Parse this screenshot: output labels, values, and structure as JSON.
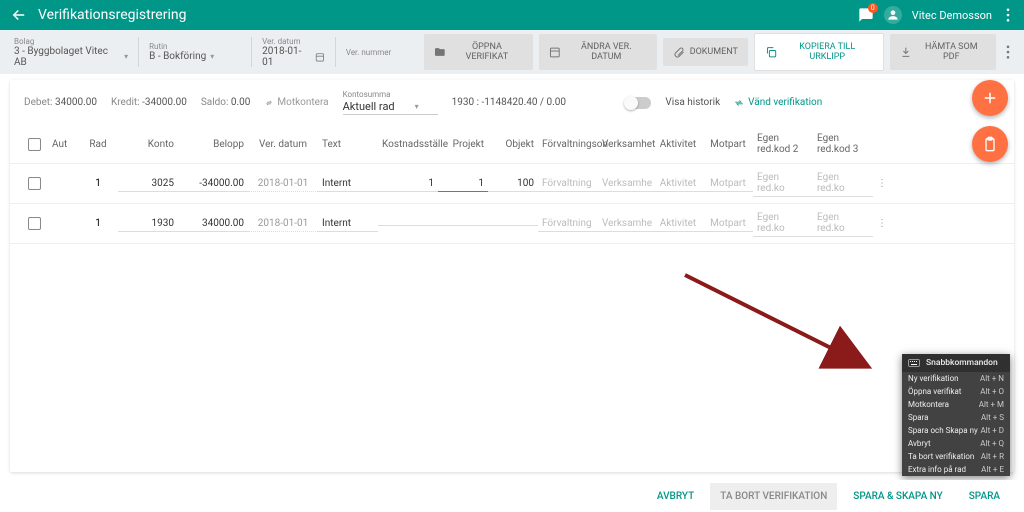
{
  "appbar": {
    "title": "Verifikationsregistrering",
    "badge": "0",
    "user": "Vitec Demosson"
  },
  "filters": {
    "bolag_label": "Bolag",
    "bolag_value": "3 - Byggbolaget Vitec AB",
    "rutin_label": "Rutin",
    "rutin_value": "B - Bokföring",
    "verdatum_label": "Ver. datum",
    "verdatum_value": "2018-01-01",
    "vernummer_label": "Ver. nummer",
    "vernummer_value": ""
  },
  "actions": {
    "open": "ÖPPNA VERIFIKAT",
    "change": "ÄNDRA VER. DATUM",
    "document": "DOKUMENT",
    "copy": "KOPIERA TILL URKLIPP",
    "pdf": "HÄMTA SOM PDF"
  },
  "summary": {
    "debet_lbl": "Debet:",
    "debet_val": "34000.00",
    "kredit_lbl": "Kredit:",
    "kredit_val": "-34000.00",
    "saldo_lbl": "Saldo:",
    "saldo_val": "0.00",
    "motkontera": "Motkontera",
    "kontosumma_lbl": "Kontosumma",
    "kontosumma_val": "Aktuell rad",
    "balance": "1930 : -1148420.40 / 0.00",
    "historik": "Visa historik",
    "vand": "Vänd verifikation"
  },
  "headers": {
    "aut": "Aut",
    "rad": "Rad",
    "konto": "Konto",
    "belopp": "Belopp",
    "verdatum": "Ver. datum",
    "text": "Text",
    "kost": "Kostnadsställe",
    "projekt": "Projekt",
    "objekt": "Objekt",
    "forv": "Förvaltningson",
    "verk": "Verksamhet",
    "akt": "Aktivitet",
    "mot": "Motpart",
    "red2": "Egen red.kod 2",
    "red3": "Egen red.kod 3"
  },
  "rows": [
    {
      "rad": "1",
      "konto": "3025",
      "belopp": "-34000.00",
      "date": "2018-01-01",
      "text": "Internt",
      "kost": "1",
      "proj": "1",
      "obj": "100",
      "forv": "Förvaltning",
      "verk": "Verksamhe",
      "akt": "Aktivitet",
      "mot": "Motpart",
      "red2": "Egen red.ko",
      "red3": "Egen red.ko"
    },
    {
      "rad": "1",
      "konto": "1930",
      "belopp": "34000.00",
      "date": "2018-01-01",
      "text": "Internt",
      "kost": "",
      "proj": "",
      "obj": "",
      "forv": "Förvaltning",
      "verk": "Verksamhe",
      "akt": "Aktivitet",
      "mot": "Motpart",
      "red2": "Egen red.ko",
      "red3": "Egen red.ko"
    }
  ],
  "shortcuts": {
    "title": "Snabbkommandon",
    "items": [
      {
        "label": "Ny verifikation",
        "key": "Alt + N"
      },
      {
        "label": "Öppna verifikat",
        "key": "Alt + O"
      },
      {
        "label": "Motkontera",
        "key": "Alt + M"
      },
      {
        "label": "Spara",
        "key": "Alt + S"
      },
      {
        "label": "Spara och Skapa ny",
        "key": "Alt + D"
      },
      {
        "label": "Avbryt",
        "key": "Alt + Q"
      },
      {
        "label": "Ta bort verifikation",
        "key": "Alt + R"
      },
      {
        "label": "Extra info på rad",
        "key": "Alt + E"
      }
    ]
  },
  "footer": {
    "cancel": "AVBRYT",
    "delete": "TA BORT VERIFIKATION",
    "create": "SPARA & SKAPA NY",
    "save": "SPARA"
  }
}
